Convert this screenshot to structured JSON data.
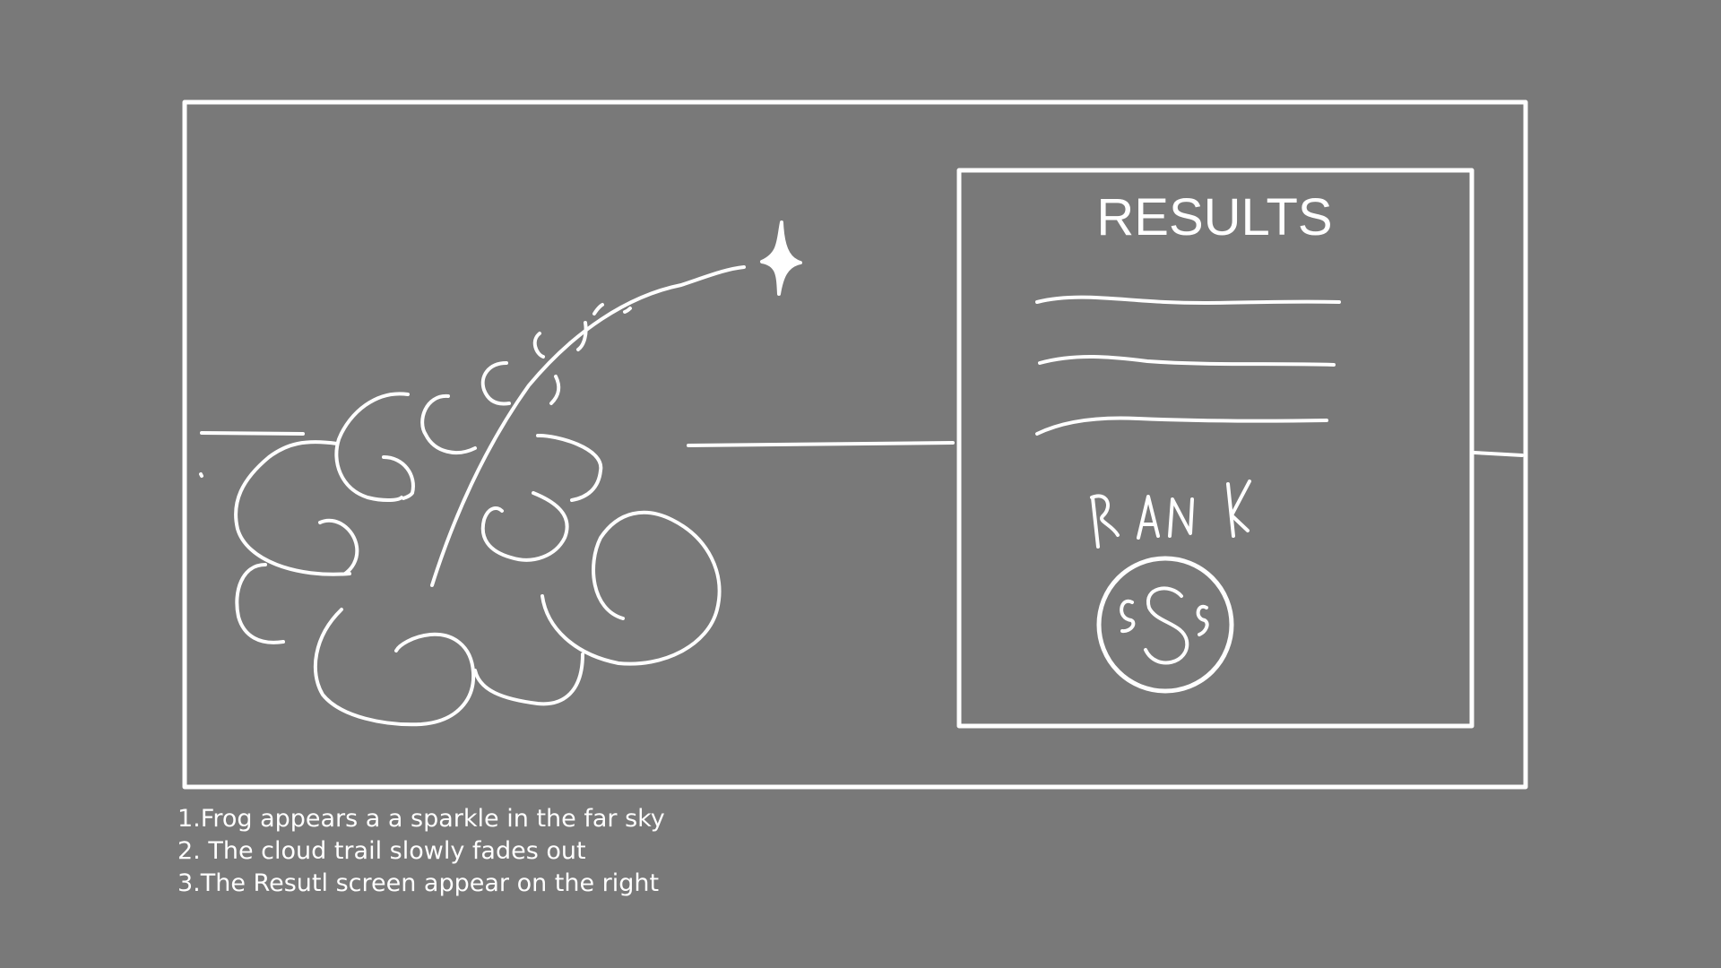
{
  "results_panel": {
    "title": "RESULTS",
    "rank_label": "RANK",
    "rank_badge": "SSS"
  },
  "notes": [
    "1.Frog appears a a sparkle in the far sky",
    "2. The cloud trail slowly fades out",
    "3.The Resutl screen appear on the right"
  ],
  "colors": {
    "background": "#797979",
    "ink": "#ffffff"
  },
  "icons": {
    "sparkle": "sparkle-icon",
    "cloud": "cloud-trail-sketch"
  }
}
